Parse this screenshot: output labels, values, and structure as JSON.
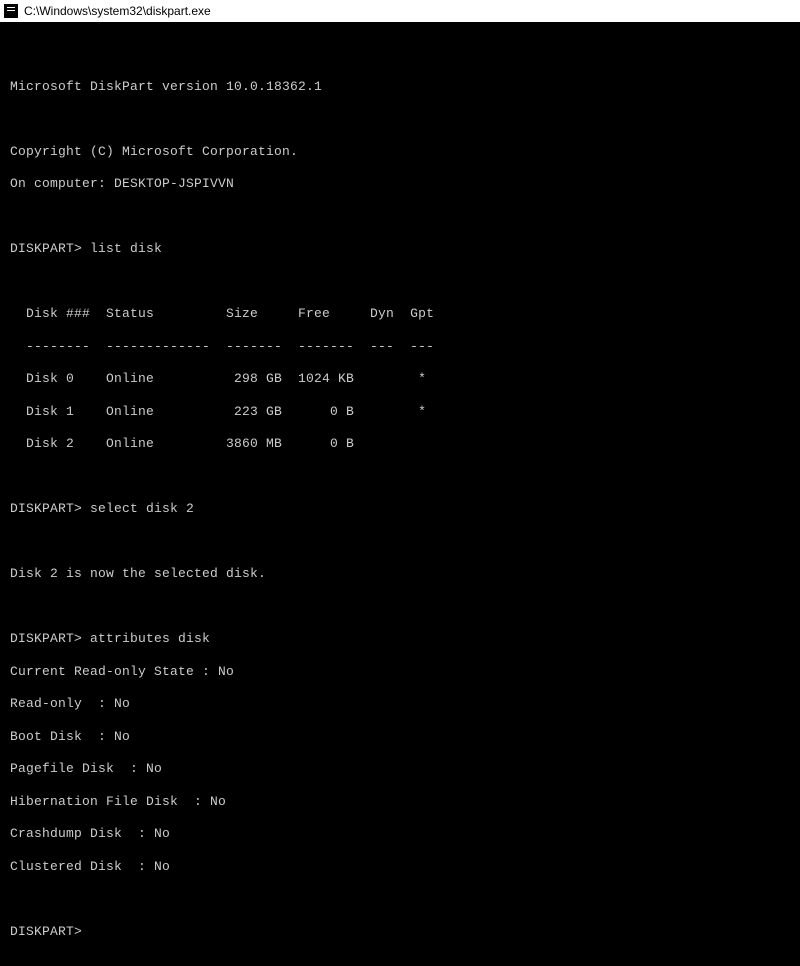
{
  "window": {
    "title": "C:\\Windows\\system32\\diskpart.exe"
  },
  "header": {
    "version_line": "Microsoft DiskPart version 10.0.18362.1",
    "copyright_line": "Copyright (C) Microsoft Corporation.",
    "computer_line": "On computer: DESKTOP-JSPIVVN"
  },
  "prompt": "DISKPART>",
  "commands": {
    "c1": "list disk",
    "c2": "select disk 2",
    "c3": "attributes disk"
  },
  "disk_table": {
    "header": "  Disk ###  Status         Size     Free     Dyn  Gpt",
    "divider": "  --------  -------------  -------  -------  ---  ---",
    "rows": [
      "  Disk 0    Online          298 GB  1024 KB        *",
      "  Disk 1    Online          223 GB      0 B        *",
      "  Disk 2    Online         3860 MB      0 B"
    ]
  },
  "select_response": "Disk 2 is now the selected disk.",
  "attributes": {
    "l1": "Current Read-only State : No",
    "l2": "Read-only  : No",
    "l3": "Boot Disk  : No",
    "l4": "Pagefile Disk  : No",
    "l5": "Hibernation File Disk  : No",
    "l6": "Crashdump Disk  : No",
    "l7": "Clustered Disk  : No"
  }
}
